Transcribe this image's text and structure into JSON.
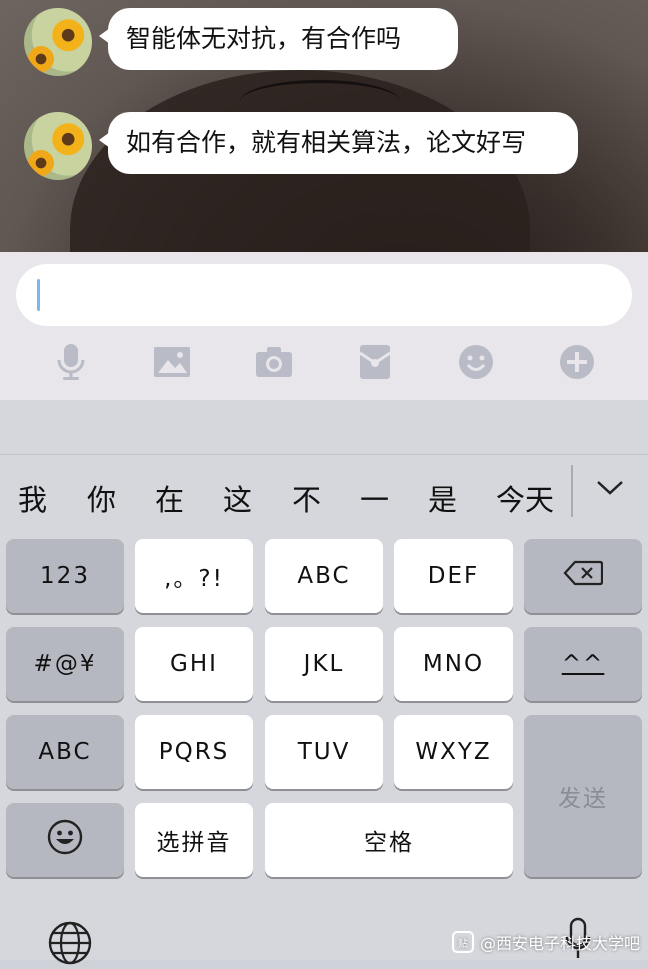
{
  "messages": [
    {
      "text": "智能体无对抗，有合作吗"
    },
    {
      "text": "如有合作，就有相关算法，论文好写"
    }
  ],
  "input": {
    "value": ""
  },
  "toolbar": {
    "icons": [
      "microphone-icon",
      "image-icon",
      "camera-icon",
      "red-packet-icon",
      "emoji-icon",
      "plus-icon"
    ]
  },
  "candidates": {
    "items": [
      "我",
      "你",
      "在",
      "这",
      "不",
      "一",
      "是",
      "今天"
    ],
    "expand_icon": "chevron-down-icon"
  },
  "keyboard": {
    "rows": [
      [
        "123",
        ",。?!",
        "ABC",
        "DEF",
        "⌫"
      ],
      [
        "#@¥",
        "GHI",
        "JKL",
        "MNO",
        "^^"
      ],
      [
        "ABC",
        "PQRS",
        "TUV",
        "WXYZ",
        "发送"
      ],
      [
        "☺",
        "选拼音",
        "空格"
      ]
    ],
    "k123": "123",
    "punct": ",。?!",
    "abc_letters": "ABC",
    "def": "DEF",
    "sym": "#@¥",
    "ghi": "GHI",
    "jkl": "JKL",
    "mno": "MNO",
    "kaomoji": "^^",
    "abc_mode": "ABC",
    "pqrs": "PQRS",
    "tuv": "TUV",
    "wxyz": "WXYZ",
    "send": "发送",
    "pinyin": "选拼音",
    "space": "空格"
  },
  "watermark": {
    "text": "@西安电子科技大学吧",
    "badge": "贴"
  },
  "colors": {
    "bubble": "#ffffff",
    "keyboard_bg": "#d5d7dc",
    "func_key": "#b5b8c0",
    "caret": "#7fb6ea"
  }
}
